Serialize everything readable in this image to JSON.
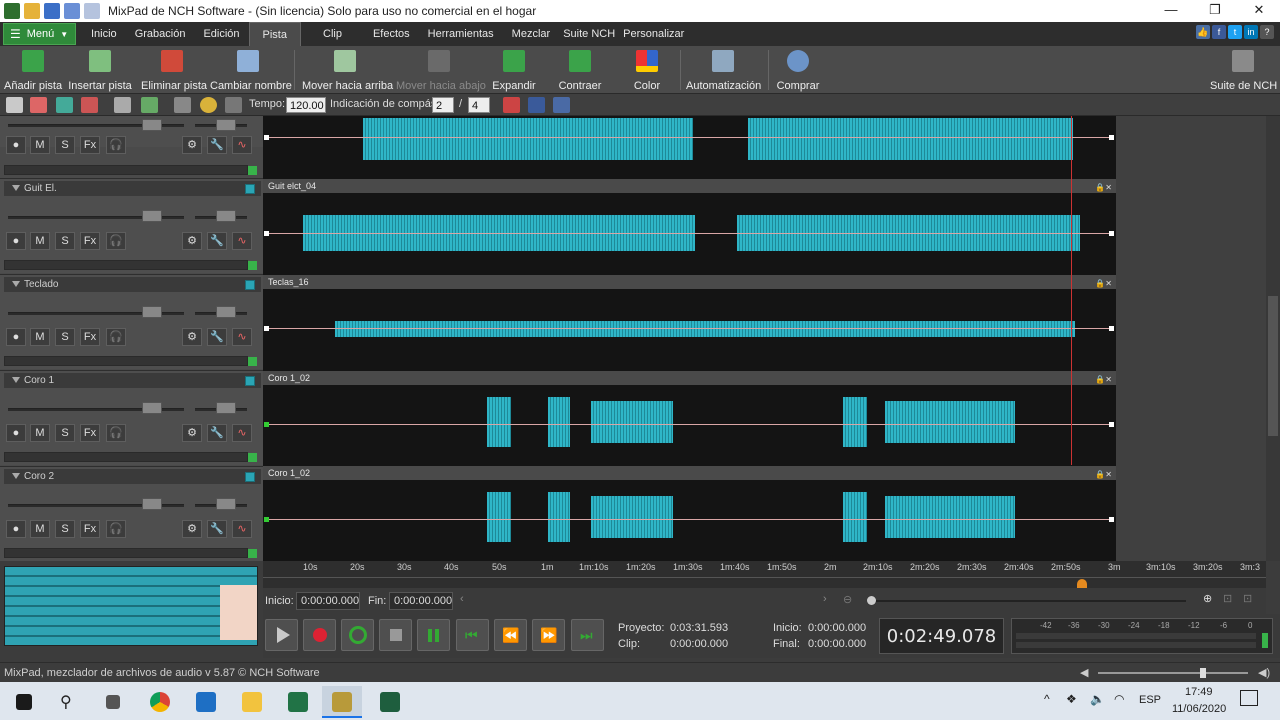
{
  "window": {
    "title": "MixPad de NCH Software - (Sin licencia) Solo para uso no comercial en el hogar",
    "controls": {
      "minimize": "—",
      "maximize": "❐",
      "close": "✕"
    }
  },
  "menubar": {
    "menu_button": "Menú",
    "tabs": [
      "Inicio",
      "Grabación",
      "Edición",
      "Pista",
      "Clip",
      "Efectos",
      "Herramientas",
      "Mezclar",
      "Suite NCH",
      "Personalizar"
    ],
    "active_tab": "Pista"
  },
  "ribbon": {
    "buttons": [
      {
        "label": "Añadir pista",
        "icon": "add-track-icon"
      },
      {
        "label": "Insertar pista",
        "icon": "insert-track-icon"
      },
      {
        "label": "Eliminar pista",
        "icon": "delete-track-icon"
      },
      {
        "label": "Cambiar nombre",
        "icon": "rename-icon"
      },
      {
        "label": "Mover hacia arriba",
        "icon": "move-up-icon"
      },
      {
        "label": "Mover hacia abajo",
        "icon": "move-down-icon"
      },
      {
        "label": "Expandir",
        "icon": "expand-icon"
      },
      {
        "label": "Contraer",
        "icon": "collapse-icon"
      },
      {
        "label": "Color",
        "icon": "color-icon"
      },
      {
        "label": "Automatización",
        "icon": "automation-icon"
      },
      {
        "label": "Comprar",
        "icon": "buy-icon"
      },
      {
        "label": "Suite de NCH",
        "icon": "nch-suite-icon"
      }
    ]
  },
  "toolbar": {
    "tempo_label": "Tempo:",
    "tempo_value": "120.00",
    "time_sig_label": "Indicación de compás:",
    "time_sig_num": "2",
    "time_sig_sep": "/",
    "time_sig_den": "4"
  },
  "tracks": [
    {
      "name": "",
      "clip": ""
    },
    {
      "name": "Guit El.",
      "clip": "Guit elct_04"
    },
    {
      "name": "Teclado",
      "clip": "Teclas_16"
    },
    {
      "name": "Coro 1",
      "clip": "Coro 1_02"
    },
    {
      "name": "Coro 2",
      "clip": "Coro 1_02"
    }
  ],
  "track_buttons": {
    "mute": "M",
    "solo": "S",
    "fx": "Fx"
  },
  "timeline": {
    "ticks": [
      "10s",
      "20s",
      "30s",
      "40s",
      "50s",
      "1m",
      "1m:10s",
      "1m:20s",
      "1m:30s",
      "1m:40s",
      "1m:50s",
      "2m",
      "2m:10s",
      "2m:20s",
      "2m:30s",
      "2m:40s",
      "2m:50s",
      "3m",
      "3m:10s",
      "3m:20s",
      "3m:3"
    ]
  },
  "selection": {
    "start_label": "Inicio:",
    "start_value": "0:00:00.000",
    "end_label": "Fin:",
    "end_value": "0:00:00.000"
  },
  "transport": {
    "project_label": "Proyecto:",
    "project_value": "0:03:31.593",
    "clip_label": "Clip:",
    "clip_value": "0:00:00.000",
    "start_label": "Inicio:",
    "start_value": "0:00:00.000",
    "end_label": "Final:",
    "end_value": "0:00:00.000",
    "current_time": "0:02:49.078",
    "vu_scale": [
      "-42",
      "-36",
      "-30",
      "-24",
      "-18",
      "-12",
      "-6",
      "0"
    ]
  },
  "status": {
    "text": "MixPad, mezclador de archivos de audio v 5.87 © NCH Software"
  },
  "taskbar": {
    "lang": "ESP",
    "time": "17:49",
    "date": "11/06/2020"
  }
}
